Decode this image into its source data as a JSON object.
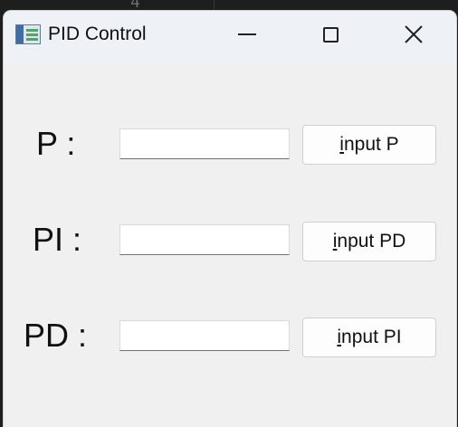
{
  "background": {
    "digit": "4"
  },
  "window": {
    "title": "PID Control",
    "icon": "app-window-icon",
    "controls": {
      "minimize_icon": "minimize-icon",
      "maximize_icon": "maximize-icon",
      "close_icon": "close-icon"
    }
  },
  "rows": [
    {
      "label": "P :",
      "input_value": "",
      "button_accel": "i",
      "button_rest": "nput P"
    },
    {
      "label": "PI :",
      "input_value": "",
      "button_accel": "i",
      "button_rest": "nput PD"
    },
    {
      "label": "PD :",
      "input_value": "",
      "button_accel": "i",
      "button_rest": "nput PI"
    }
  ],
  "colors": {
    "titlebar": "#eef2f6",
    "client": "#f0f0f0",
    "button_face": "#fdfdfd"
  }
}
